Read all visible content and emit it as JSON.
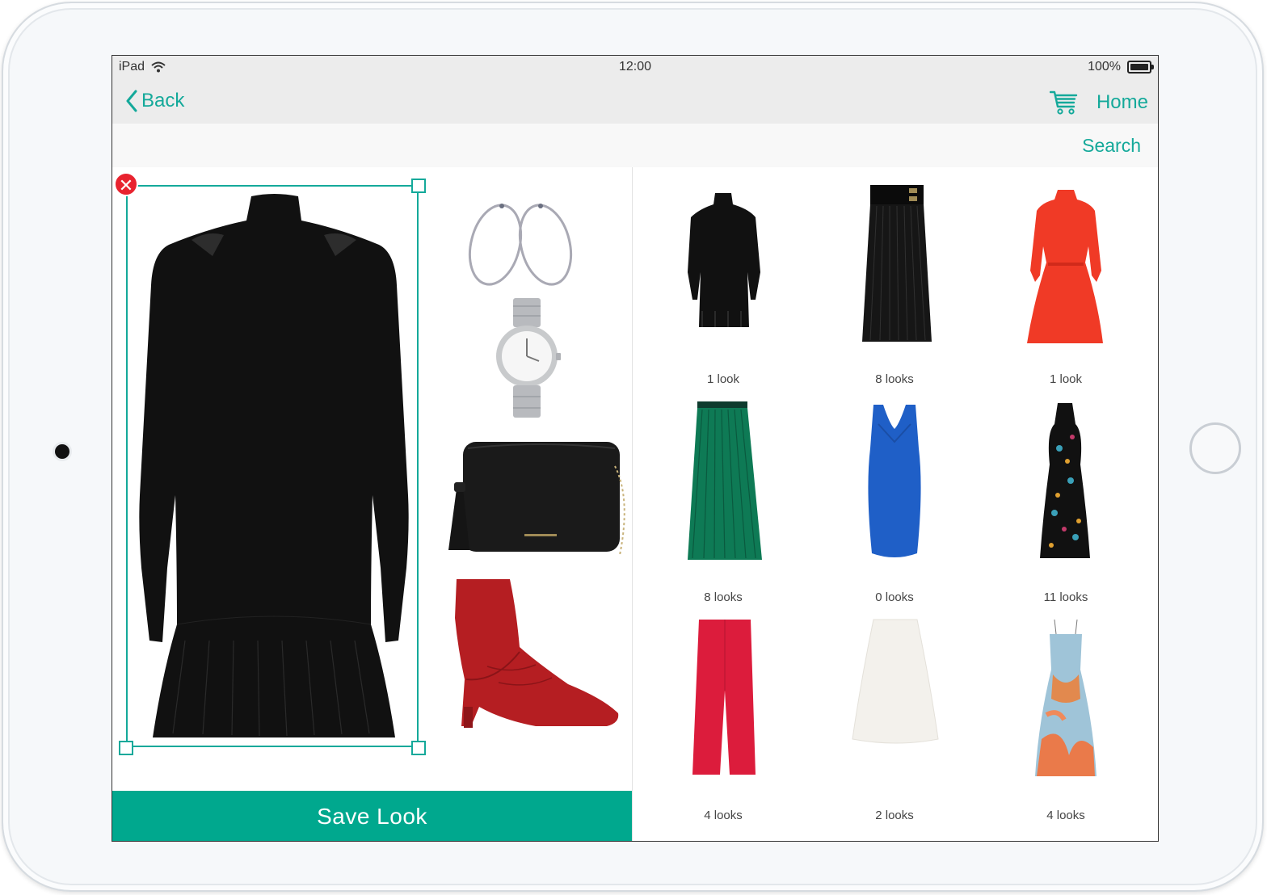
{
  "status_bar": {
    "device": "iPad",
    "time": "12:00",
    "battery": "100%"
  },
  "nav": {
    "back_label": "Back",
    "home_label": "Home"
  },
  "search": {
    "label": "Search"
  },
  "editor": {
    "save_label": "Save Look",
    "remove_symbol": "✕"
  },
  "colors": {
    "accent": "#14a99a",
    "save": "#00a88e",
    "remove": "#e8232f"
  },
  "catalog": [
    {
      "count": "1 look"
    },
    {
      "count": "8 looks"
    },
    {
      "count": "1 look"
    },
    {
      "count": "8 looks"
    },
    {
      "count": "0 looks"
    },
    {
      "count": "11 looks"
    },
    {
      "count": "4 looks"
    },
    {
      "count": "2 looks"
    },
    {
      "count": "4 looks"
    }
  ]
}
